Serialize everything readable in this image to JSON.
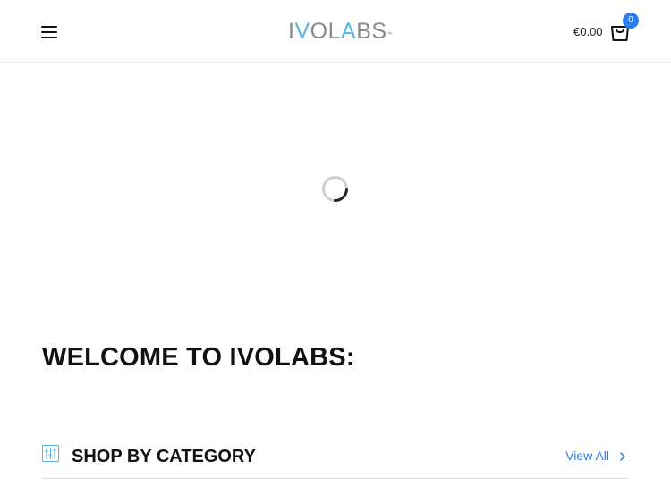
{
  "header": {
    "logo_text": "IVOLABS",
    "logo_tm": "™",
    "cart_amount": "€0.00",
    "cart_count": "0"
  },
  "main": {
    "welcome_heading": "WELCOME TO IVOLABS:",
    "category_title": "SHOP BY CATEGORY",
    "view_all_label": "View All"
  },
  "icons": {
    "menu": "hamburger-menu-icon",
    "cart": "shopping-bag-icon",
    "loading": "loading-spinner-icon",
    "category": "sliders-icon",
    "view_all": "chevron-right-icon"
  },
  "colors": {
    "accent": "#2a7df0",
    "logo_gray": "#8a8a8a",
    "logo_blue": "#5bb3e6",
    "link": "#2a7de1"
  }
}
